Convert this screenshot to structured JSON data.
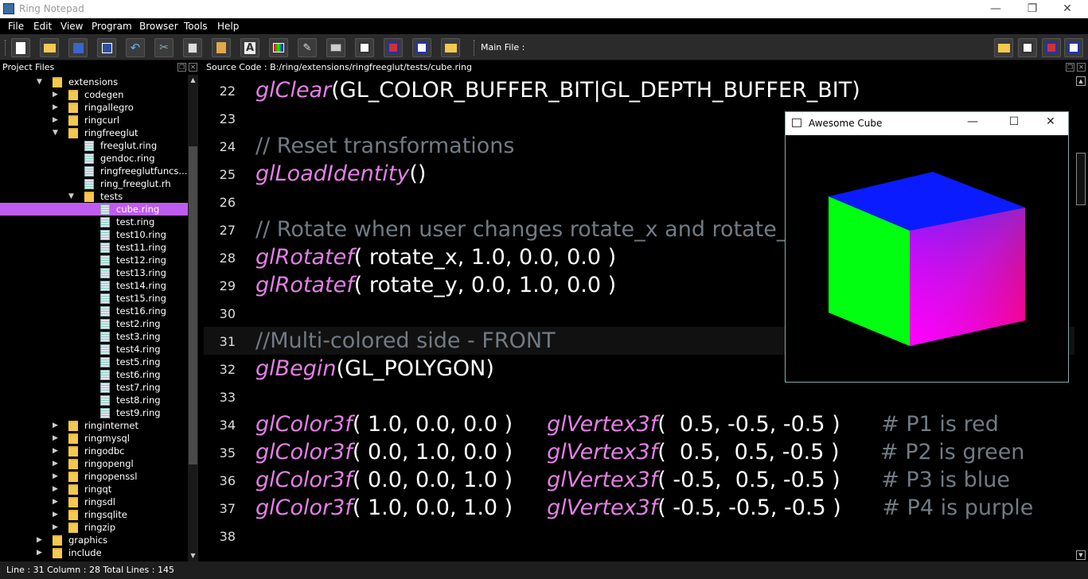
{
  "window": {
    "title": "Ring Notepad",
    "minimize": "—",
    "restore": "❐",
    "close": "✕"
  },
  "menu": [
    "File",
    "Edit",
    "View",
    "Program",
    "Browser",
    "Tools",
    "Help"
  ],
  "toolbar": {
    "main_file_label": "Main File :"
  },
  "project_panel": {
    "title": "Project Files"
  },
  "source_panel": {
    "title": "Source Code : B:/ring/extensions/ringfreeglut/tests/cube.ring"
  },
  "tree": [
    {
      "label": "extensions",
      "type": "folder",
      "level": 2,
      "expanded": true
    },
    {
      "label": "codegen",
      "type": "folder",
      "level": 3
    },
    {
      "label": "ringallegro",
      "type": "folder",
      "level": 3
    },
    {
      "label": "ringcurl",
      "type": "folder",
      "level": 3
    },
    {
      "label": "ringfreeglut",
      "type": "folder",
      "level": 3,
      "expanded": true
    },
    {
      "label": "freeglut.ring",
      "type": "file",
      "level": 4
    },
    {
      "label": "gendoc.ring",
      "type": "file",
      "level": 4
    },
    {
      "label": "ringfreeglutfuncs...",
      "type": "file",
      "level": 4
    },
    {
      "label": "ring_freeglut.rh",
      "type": "file",
      "level": 4
    },
    {
      "label": "tests",
      "type": "folder",
      "level": 4,
      "expanded": true
    },
    {
      "label": "cube.ring",
      "type": "file",
      "level": 5,
      "selected": true
    },
    {
      "label": "test.ring",
      "type": "file",
      "level": 5
    },
    {
      "label": "test10.ring",
      "type": "file",
      "level": 5
    },
    {
      "label": "test11.ring",
      "type": "file",
      "level": 5
    },
    {
      "label": "test12.ring",
      "type": "file",
      "level": 5
    },
    {
      "label": "test13.ring",
      "type": "file",
      "level": 5
    },
    {
      "label": "test14.ring",
      "type": "file",
      "level": 5
    },
    {
      "label": "test15.ring",
      "type": "file",
      "level": 5
    },
    {
      "label": "test16.ring",
      "type": "file",
      "level": 5
    },
    {
      "label": "test2.ring",
      "type": "file",
      "level": 5
    },
    {
      "label": "test3.ring",
      "type": "file",
      "level": 5
    },
    {
      "label": "test4.ring",
      "type": "file",
      "level": 5
    },
    {
      "label": "test5.ring",
      "type": "file",
      "level": 5
    },
    {
      "label": "test6.ring",
      "type": "file",
      "level": 5
    },
    {
      "label": "test7.ring",
      "type": "file",
      "level": 5
    },
    {
      "label": "test8.ring",
      "type": "file",
      "level": 5
    },
    {
      "label": "test9.ring",
      "type": "file",
      "level": 5
    },
    {
      "label": "ringinternet",
      "type": "folder",
      "level": 3
    },
    {
      "label": "ringmysql",
      "type": "folder",
      "level": 3
    },
    {
      "label": "ringodbc",
      "type": "folder",
      "level": 3
    },
    {
      "label": "ringopengl",
      "type": "folder",
      "level": 3
    },
    {
      "label": "ringopenssl",
      "type": "folder",
      "level": 3
    },
    {
      "label": "ringqt",
      "type": "folder",
      "level": 3
    },
    {
      "label": "ringsdl",
      "type": "folder",
      "level": 3
    },
    {
      "label": "ringsqlite",
      "type": "folder",
      "level": 3
    },
    {
      "label": "ringzip",
      "type": "folder",
      "level": 3
    },
    {
      "label": "graphics",
      "type": "folder",
      "level": 2
    },
    {
      "label": "include",
      "type": "folder",
      "level": 2
    }
  ],
  "code_lines": [
    {
      "n": "22",
      "parts": [
        {
          "t": "glClear",
          "c": "fn"
        },
        {
          "t": "(GL_COLOR_BUFFER_BIT|GL_DEPTH_BUFFER_BIT)",
          "c": "tx"
        }
      ]
    },
    {
      "n": "23",
      "parts": []
    },
    {
      "n": "24",
      "parts": [
        {
          "t": "// Reset transformations",
          "c": "cm"
        }
      ]
    },
    {
      "n": "25",
      "parts": [
        {
          "t": "glLoadIdentity",
          "c": "fn"
        },
        {
          "t": "()",
          "c": "tx"
        }
      ]
    },
    {
      "n": "26",
      "parts": []
    },
    {
      "n": "27",
      "parts": [
        {
          "t": "// Rotate when user changes rotate_x and rotate_y",
          "c": "cm"
        }
      ]
    },
    {
      "n": "28",
      "parts": [
        {
          "t": "glRotatef",
          "c": "fn"
        },
        {
          "t": "( rotate_x, 1.0, 0.0, 0.0 )",
          "c": "tx"
        }
      ]
    },
    {
      "n": "29",
      "parts": [
        {
          "t": "glRotatef",
          "c": "fn"
        },
        {
          "t": "( rotate_y, 0.0, 1.0, 0.0 )",
          "c": "tx"
        }
      ]
    },
    {
      "n": "30",
      "parts": []
    },
    {
      "n": "31",
      "parts": [
        {
          "t": "//Multi-colored side - FRONT",
          "c": "cm"
        }
      ],
      "current": true
    },
    {
      "n": "32",
      "parts": [
        {
          "t": "glBegin",
          "c": "fn"
        },
        {
          "t": "(GL_POLYGON)",
          "c": "tx"
        }
      ]
    },
    {
      "n": "33",
      "parts": []
    },
    {
      "n": "34",
      "parts": [
        {
          "t": "glColor3f",
          "c": "fn"
        },
        {
          "t": "( 1.0, 0.0, 0.0 )     ",
          "c": "tx"
        },
        {
          "t": "glVertex3f",
          "c": "fn"
        },
        {
          "t": "(  0.5, -0.5, -0.5 )      ",
          "c": "tx"
        },
        {
          "t": "# P1 is red",
          "c": "cm"
        }
      ]
    },
    {
      "n": "35",
      "parts": [
        {
          "t": "glColor3f",
          "c": "fn"
        },
        {
          "t": "( 0.0, 1.0, 0.0 )     ",
          "c": "tx"
        },
        {
          "t": "glVertex3f",
          "c": "fn"
        },
        {
          "t": "(  0.5,  0.5, -0.5 )      ",
          "c": "tx"
        },
        {
          "t": "# P2 is green",
          "c": "cm"
        }
      ]
    },
    {
      "n": "36",
      "parts": [
        {
          "t": "glColor3f",
          "c": "fn"
        },
        {
          "t": "( 0.0, 0.0, 1.0 )     ",
          "c": "tx"
        },
        {
          "t": "glVertex3f",
          "c": "fn"
        },
        {
          "t": "( -0.5,  0.5, -0.5 )      ",
          "c": "tx"
        },
        {
          "t": "# P3 is blue",
          "c": "cm"
        }
      ]
    },
    {
      "n": "37",
      "parts": [
        {
          "t": "glColor3f",
          "c": "fn"
        },
        {
          "t": "( 1.0, 0.0, 1.0 )     ",
          "c": "tx"
        },
        {
          "t": "glVertex3f",
          "c": "fn"
        },
        {
          "t": "( -0.5, -0.5, -0.5 )      ",
          "c": "tx"
        },
        {
          "t": "# P4 is purple",
          "c": "cm"
        }
      ]
    },
    {
      "n": "38",
      "parts": []
    }
  ],
  "status": {
    "text": "Line : 31 Column : 28 Total Lines : 145"
  },
  "cube_window": {
    "title": "Awesome Cube",
    "minimize": "—",
    "maximize": "☐",
    "close": "✕"
  },
  "colors": {
    "function": "#e57fe6",
    "comment": "#717b84",
    "selection": "#bf5cf0"
  }
}
